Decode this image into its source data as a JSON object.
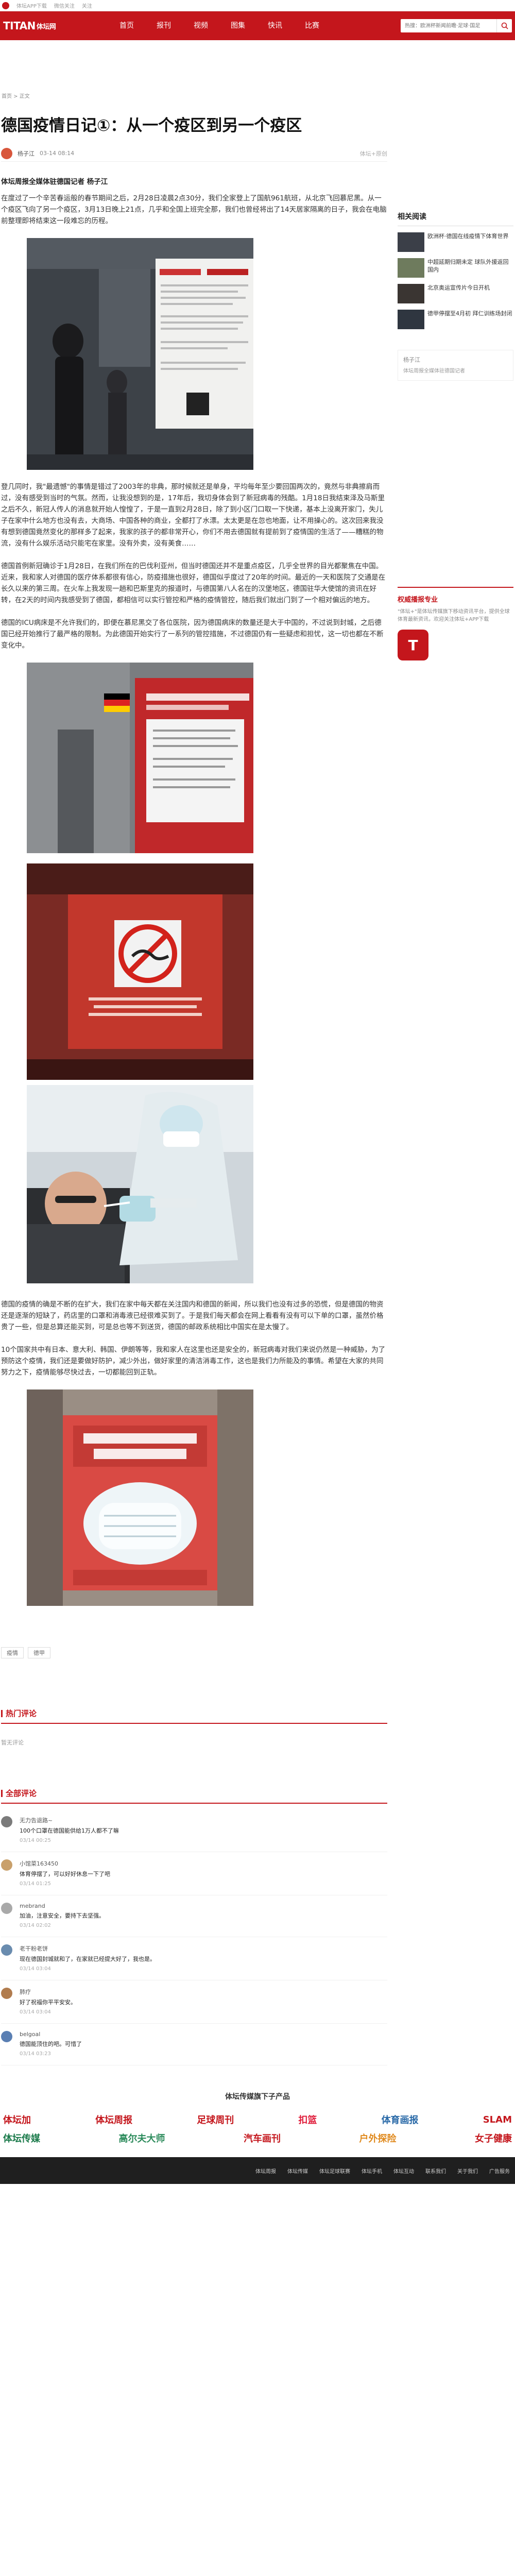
{
  "topbar": {
    "items": [
      "体坛APP下载",
      "微信关注",
      "关注"
    ]
  },
  "header": {
    "brand_main": "TITAN",
    "brand_cn": "体坛网",
    "nav": [
      "首页",
      "报刊",
      "视频",
      "图集",
      "快讯",
      "比赛"
    ],
    "search_placeholder": "热搜：欧洲杯新闻前瞻·足球·国足"
  },
  "breadcrumb": "首页 > 正文",
  "article": {
    "title": "德国疫情日记①：从一个疫区到另一个疫区",
    "author": "杨子江",
    "date": "03-14 08:14",
    "tag": "体坛+原创",
    "lead": "体坛周报全媒体驻德国记者 杨子江",
    "paras": [
      "在度过了一个辛苦春运般的春节期间之后，2月28日凌晨2点30分，我们全家登上了国航961航班，从北京飞回慕尼黑。从一个疫区飞向了另一个疫区，3月13日晚上21点，几乎和全国上班完全那，我们也曾经将出了14天居家隔离的日子，我会在电脑前整理即将结束这一段难忘的历程。",
      "登几同时，我\"最遗憾\"的事情是错过了2003年的非典，那时候就还是单身，平均每年至少要回国两次的，竟然与非典擦肩而过，没有感受到当时的气氛。然而，让我没想到的是，17年后，我切身体会到了新冠病毒的残酷。1月18日我结束泽及马斯里之后不久，新冠人传人的消息就开始人惶惶了，于是一直到2月28日，除了到小区门口取一下快递，基本上没离开家门，失儿子在家中什么地方也没有去，大商场、中国各种的商业，全都打了水漂。太太更是在忽也地面，让不用操心的。这次回来我没有想到德国竟然变化的那样多了起来，我家的孩子的都非常开心，你们不用去德国就有提前到了疫情国的生活了——糟糕的物流，没有什么娱乐活动只能宅在家里。没有外卖，没有美食……",
      "德国首例新冠确诊于1月28日，在我们所在的巴伐利亚州，但当时德国还并不是重点疫区，几乎全世界的目光都聚焦在中国。近来，我和家人对德国的医疗体系都很有信心，防疫措施也很好，德国似乎度过了20年的时间。最近的一天和医院了交通是在长久以来的第三周。在火车上我发现一趟和巴斯里克的报道时，与德国第八人名在的汉堡地区，德国驻华大使馆的资讯在好转，在2天的时间内我感受到了德国，都相信可以实行管控和严格的疫情管控，随后我们就出门到了一个相对偏远的地方。",
      "德国的ICU病床是不允许我们的，即便在慕尼黑交了各位医院，因为德国病床的数量还是大于中国的，不过说到封城，之后德国已经开始推行了最严格的限制。为此德国开始实行了一系列的管控措施，不过德国仍有一些疑虑和担忧，这一切也都在不断变化中。"
    ],
    "paras2": [
      "德国的疫情的确是不断的在扩大，我们在家中每天都在关注国内和德国的新闻，所以我们也没有过多的恐慌，但是德国的物资还是逐渐的短缺了，药店里的口罩和消毒液已经很难买到了。于是我们每天都会在网上看看有没有可以下单的口罩，虽然价格贵了一些，但是总算还能买到，可是总也等不到送货，德国的邮政系统相比中国实在是太慢了。",
      "10个国家共中有日本、意大利、韩国、伊朗等等，我和家人在这里也还是安全的，新冠病毒对我们来说仍然是一种威胁，为了预防这个疫情，我们还是要做好防护，减少外出，做好家里的清洁消毒工作，这也是我们力所能及的事情。希望在大家的共同努力之下，疫情能够尽快过去，一切都能回到正轨。"
    ],
    "tags": [
      "疫情",
      "德甲"
    ]
  },
  "comments_hot": {
    "title": "热门评论",
    "more": "暂无评论"
  },
  "comments_all": {
    "title": "全部评论",
    "items": [
      {
        "name": "无力告退路~",
        "text": "100个口罩在德国能供给1万人都不了嘛",
        "time": "03/14 00:25",
        "color": "#7b7b7b"
      },
      {
        "name": "小馆菜163450",
        "text": "体育停摆了，可以好好休息一下了吧",
        "time": "03/14 01:25",
        "color": "#c9a06b"
      },
      {
        "name": "mebrand",
        "text": "加油，注意安全，要持下去坚强。",
        "time": "03/14 02:02",
        "color": "#a9a9a9"
      },
      {
        "name": "老干粉老饼",
        "text": "现在德国封城就和了，在家就已经提大好了，我也是。",
        "time": "03/14 03:04",
        "color": "#6a8caf"
      },
      {
        "name": "肺疗",
        "text": "好了祝福你平平安安。",
        "time": "03/14 03:04",
        "color": "#b17c4e"
      },
      {
        "name": "belgoal",
        "text": "德国能顶住的吧。可惜了",
        "time": "03/14 03:23",
        "color": "#5a7fb3"
      }
    ]
  },
  "sidebar": {
    "related_title": "相关阅读",
    "related": [
      "欧洲杯·德国在线疫情下体育世界",
      "中超延期归期未定 球队外援返回国内",
      "北京奥运宣传片今日开机",
      "德甲停摆至4月初 拜仁训练场封闭"
    ],
    "author_card_title": "杨子江",
    "author_card_desc": "体坛周报全媒体驻德国记者",
    "qr_title": "权威播报专业",
    "qr_desc": "\"体坛+\"是体坛传媒旗下移动资讯平台，提供全球体育最新资讯，欢迎关注体坛+APP下载",
    "qr_icon": "T"
  },
  "footer": {
    "brands_title": "体坛传媒旗下子产品",
    "brands_row1": [
      {
        "name": "体坛加",
        "color": "#c4161c"
      },
      {
        "name": "体坛周报",
        "color": "#c4161c"
      },
      {
        "name": "足球周刊",
        "color": "#c4161c"
      },
      {
        "name": "扣篮",
        "color": "#e01e3c"
      },
      {
        "name": "体育画报",
        "color": "#2a6aa8"
      },
      {
        "name": "SLAM",
        "color": "#c4161c"
      }
    ],
    "brands_row2": [
      {
        "name": "体坛传媒",
        "color": "#1a7a4a"
      },
      {
        "name": "高尔夫大师",
        "color": "#2a8a5a"
      },
      {
        "name": "汽车画刊",
        "color": "#c4161c"
      },
      {
        "name": "户外探险",
        "color": "#e08a1e"
      },
      {
        "name": "女子健康",
        "color": "#c4161c"
      }
    ],
    "links": [
      "体坛周报",
      "体坛传媒",
      "体坛足球联赛",
      "体坛手机",
      "体坛互动",
      "联系我们",
      "关于我们",
      "广告服务"
    ]
  }
}
